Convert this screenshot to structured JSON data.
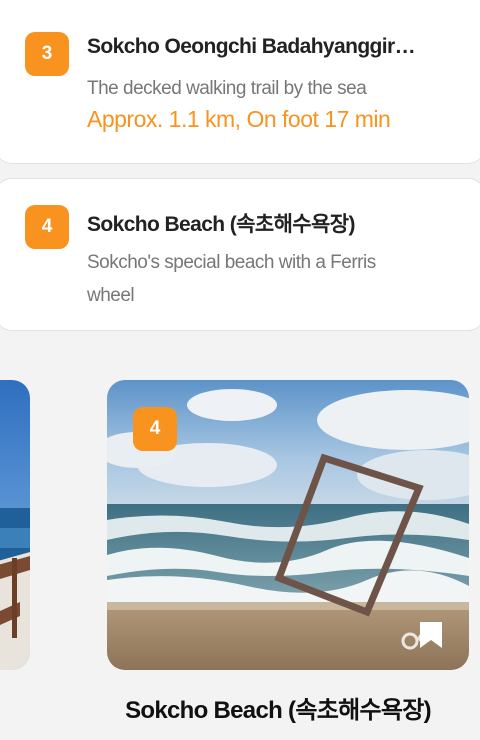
{
  "cards": [
    {
      "number": "3",
      "title": "Sokcho Oeongchi Badahyanggir…",
      "description": "The decked walking trail by the sea",
      "distance": "Approx. 1.1 km, On foot 17 min"
    },
    {
      "number": "4",
      "title": "Sokcho Beach (속초해수욕장)",
      "description": "Sokcho's special beach with a Ferris wheel"
    }
  ],
  "photo_card": {
    "number": "4",
    "caption": "Sokcho Beach (속초해수욕장)",
    "bookmark_icon": "bookmark-icon",
    "watermark_icon": "tourism-logo-watermark"
  },
  "colors": {
    "accent": "#f7931e",
    "background": "#f3f3f3",
    "card": "#ffffff"
  }
}
